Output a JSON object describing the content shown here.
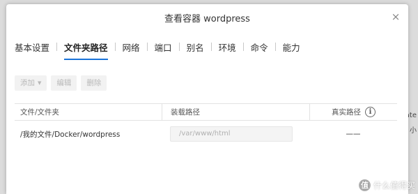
{
  "background": {
    "peek_text": [
      "ate",
      "小"
    ]
  },
  "modal": {
    "title": "查看容器 wordpress",
    "close": "×"
  },
  "tabs": [
    {
      "label": "基本设置",
      "active": false
    },
    {
      "label": "文件夹路径",
      "active": true
    },
    {
      "label": "网络",
      "active": false
    },
    {
      "label": "端口",
      "active": false
    },
    {
      "label": "别名",
      "active": false
    },
    {
      "label": "环境",
      "active": false
    },
    {
      "label": "命令",
      "active": false
    },
    {
      "label": "能力",
      "active": false
    }
  ],
  "toolbar": {
    "add_label": "添加",
    "edit_label": "编辑",
    "delete_label": "删除"
  },
  "table": {
    "headers": [
      "文件/文件夹",
      "装载路径",
      "真实路径"
    ],
    "info_glyph": "i",
    "rows": [
      {
        "folder": "/我的文件/Docker/wordpress",
        "mount_path": "/var/www/html",
        "real_path": "——"
      }
    ]
  },
  "watermark": {
    "logo": "值",
    "text": "什么值得买"
  },
  "colors": {
    "accent": "#1a73d9",
    "disabled_text": "#b8b8b8"
  }
}
